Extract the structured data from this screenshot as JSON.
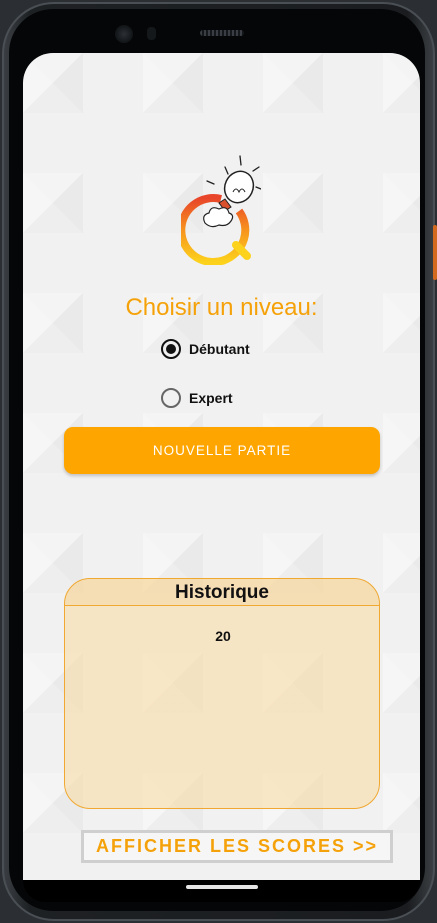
{
  "app": {
    "title": "Choisir un niveau:",
    "accent_color": "#ffa500",
    "logo_icon": "lightbulb-quiz-logo-icon"
  },
  "levels": {
    "options": [
      {
        "label": "Débutant",
        "selected": true
      },
      {
        "label": "Expert",
        "selected": false
      }
    ]
  },
  "actions": {
    "new_game_label": "NOUVELLE PARTIE",
    "show_scores_label": "AFFICHER LES SCORES >>"
  },
  "history": {
    "title": "Historique",
    "entries": [
      "20"
    ]
  }
}
